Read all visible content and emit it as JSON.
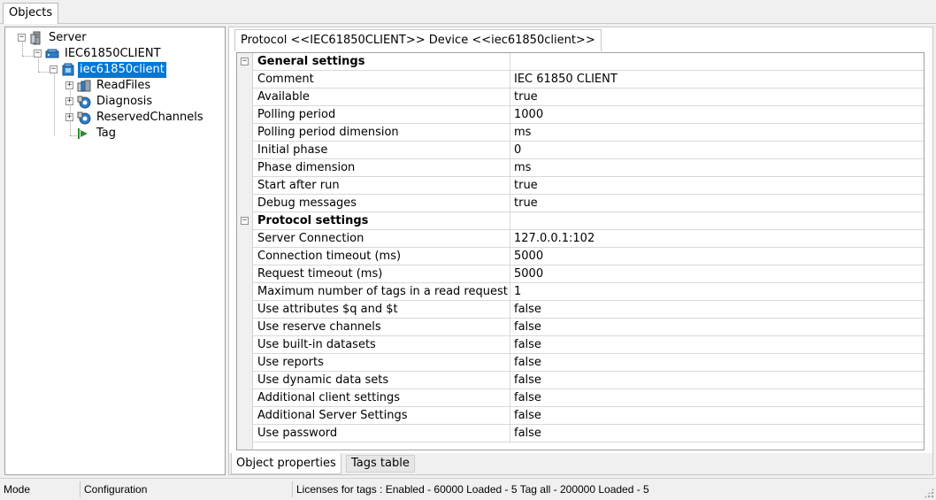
{
  "window": {
    "top_tab_label": "Objects"
  },
  "tree": {
    "items": [
      {
        "label": "Server",
        "icon": "server-icon",
        "expander": "−"
      },
      {
        "label": "IEC61850CLIENT",
        "icon": "protocol-icon",
        "expander": "−"
      },
      {
        "label": "iec61850client",
        "icon": "device-icon",
        "expander": "−",
        "selected": true
      },
      {
        "label": "ReadFiles",
        "icon": "folder-group-icon",
        "expander": "+"
      },
      {
        "label": "Diagnosis",
        "icon": "diagnosis-icon",
        "expander": "+"
      },
      {
        "label": "ReservedChannels",
        "icon": "channels-icon",
        "expander": "+"
      },
      {
        "label": "Tag",
        "icon": "tag-arrow-icon",
        "expander": ""
      }
    ]
  },
  "header_tab_label": "Protocol <<IEC61850CLIENT>> Device <<iec61850client>>",
  "grid": {
    "rows": [
      {
        "name": "General settings",
        "value": "",
        "section": true
      },
      {
        "name": "Comment",
        "value": "IEC 61850 CLIENT"
      },
      {
        "name": "Available",
        "value": "true"
      },
      {
        "name": "Polling period",
        "value": "1000"
      },
      {
        "name": "Polling period dimension",
        "value": "ms"
      },
      {
        "name": "Initial phase",
        "value": "0"
      },
      {
        "name": "Phase dimension",
        "value": "ms"
      },
      {
        "name": "Start after run",
        "value": "true"
      },
      {
        "name": "Debug messages",
        "value": "true"
      },
      {
        "name": "Protocol settings",
        "value": "",
        "section": true
      },
      {
        "name": "Server Connection",
        "value": "127.0.0.1:102"
      },
      {
        "name": "Connection timeout (ms)",
        "value": "5000"
      },
      {
        "name": "Request timeout (ms)",
        "value": "5000"
      },
      {
        "name": "Maximum number of tags in a read request",
        "value": "1"
      },
      {
        "name": "Use attributes $q and $t",
        "value": "false"
      },
      {
        "name": "Use reserve channels",
        "value": "false"
      },
      {
        "name": "Use built-in datasets",
        "value": "false"
      },
      {
        "name": "Use reports",
        "value": "false"
      },
      {
        "name": "Use dynamic data sets",
        "value": "false"
      },
      {
        "name": "Additional client settings",
        "value": "false"
      },
      {
        "name": "Additional Server Settings",
        "value": "false"
      },
      {
        "name": "Use password",
        "value": "false"
      }
    ]
  },
  "bottom_tabs": [
    {
      "label": "Object properties",
      "active": true
    },
    {
      "label": "Tags table",
      "active": false
    }
  ],
  "status_bar": {
    "mode": "Mode",
    "configuration": "Configuration",
    "licenses": "Licenses for tags : Enabled - 60000  Loaded - 5 Tag all - 200000  Loaded - 5"
  },
  "colors": {
    "selection": "#0078d7",
    "icon_blue": "#2a7fc9",
    "arrow_green": "#2e8b2e"
  }
}
